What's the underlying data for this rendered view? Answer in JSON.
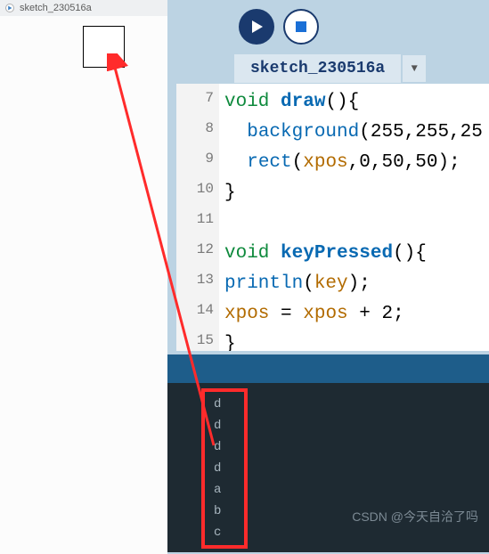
{
  "run_window": {
    "title": "sketch_230516a"
  },
  "editor": {
    "tab_label": "sketch_230516a",
    "dropdown_glyph": "▼",
    "line_numbers": [
      "7",
      "8",
      "9",
      "10",
      "11",
      "12",
      "13",
      "14",
      "15"
    ],
    "code_tokens": {
      "l7_kw": "void",
      "l7_fn": "draw",
      "l7_tail": "(){",
      "l8_in": "  ",
      "l8_call": "background",
      "l8_tail": "(255,255,25",
      "l9_in": "  ",
      "l9_call": "rect",
      "l9_a": "(",
      "l9_v": "xpos",
      "l9_b": ",0,50,50);",
      "l10": "}",
      "l11": "",
      "l12_kw": "void",
      "l12_fn": "keyPressed",
      "l12_tail": "(){",
      "l13_call": "println",
      "l13_a": "(",
      "l13_v": "key",
      "l13_b": ");",
      "l14_a": "xpos",
      "l14_b": " = ",
      "l14_c": "xpos",
      "l14_d": " + 2;",
      "l15": "}"
    }
  },
  "console": {
    "lines": [
      "d",
      "d",
      "d",
      "d",
      "a",
      "b",
      "c"
    ]
  },
  "watermark": "CSDN @今天自洽了吗"
}
